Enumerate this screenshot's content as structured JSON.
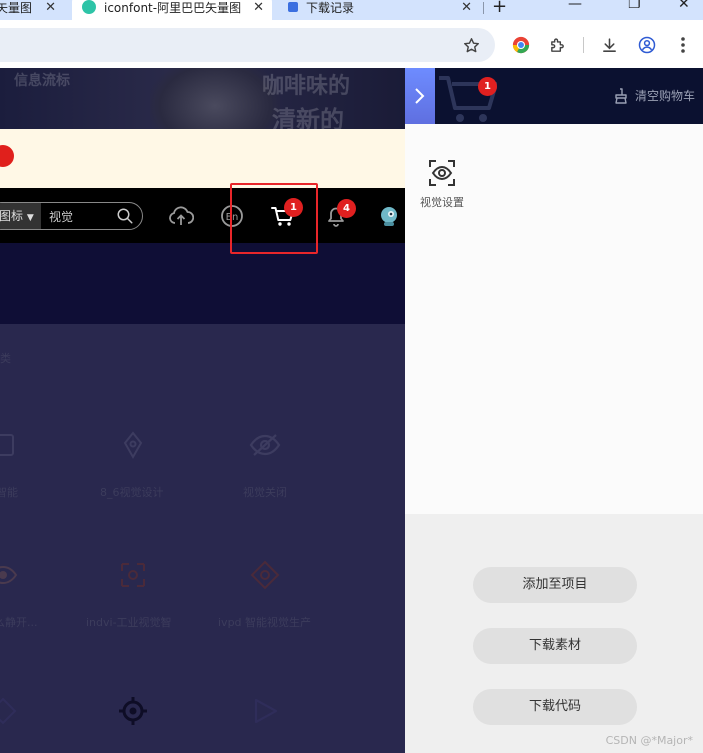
{
  "browser": {
    "tabs": [
      {
        "title": "矢量图",
        "active": false
      },
      {
        "title": "iconfont-阿里巴巴矢量图",
        "active": true
      },
      {
        "title": "下载记录",
        "active": false
      }
    ],
    "tab_close": "✕",
    "new_tab": "+",
    "window_controls": {
      "minimize": "—",
      "restore": "❐",
      "close": "✕"
    }
  },
  "page": {
    "banner_texts": [
      "信息流标",
      "咖啡味的",
      "清新的"
    ],
    "search": {
      "type_label": "图标",
      "query": "视觉"
    },
    "nav_badges": {
      "cart": "1",
      "notifications": "4"
    },
    "content_labels": [
      "类",
      "智能",
      "8_6视觉设计",
      "视觉关闭",
      "么静开...",
      "indvi-工业视觉智",
      "ivpd 智能视觉生产"
    ]
  },
  "side_panel": {
    "cart_count": "1",
    "clear_cart": "清空购物车",
    "items": [
      {
        "label": "视觉设置",
        "icon": "eye-scan-icon"
      }
    ],
    "buttons": {
      "add_to_project": "添加至项目",
      "download_assets": "下载素材",
      "download_code": "下载代码"
    }
  },
  "watermark": "CSDN @*Major*",
  "colors": {
    "accent_red": "#e8262a",
    "badge_red": "#e02020",
    "panel_header": "#0b1130",
    "notice_bg": "#fff8e6"
  }
}
